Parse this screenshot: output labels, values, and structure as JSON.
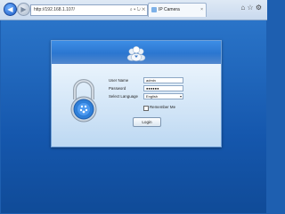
{
  "browser": {
    "address": "http://192.168.1.107/",
    "address_icons": "⌕ ▾ ↻ ✕",
    "tab_title": "IP Camera",
    "tab_close": "×",
    "toolbar_icons": "⌂ ☆ ⚙",
    "window_controls": "– □ ✕"
  },
  "login": {
    "username_label": "User Name",
    "username_value": "admin",
    "password_label": "Password",
    "password_value": "●●●●●●",
    "language_label": "Select Language",
    "language_value": "English",
    "remember_label": "Remember Me",
    "login_button": "Login"
  },
  "colors": {
    "page_background": "#1e5fb0",
    "panel_header": "#2a78d4",
    "lock_accent": "#2f7fd8"
  }
}
